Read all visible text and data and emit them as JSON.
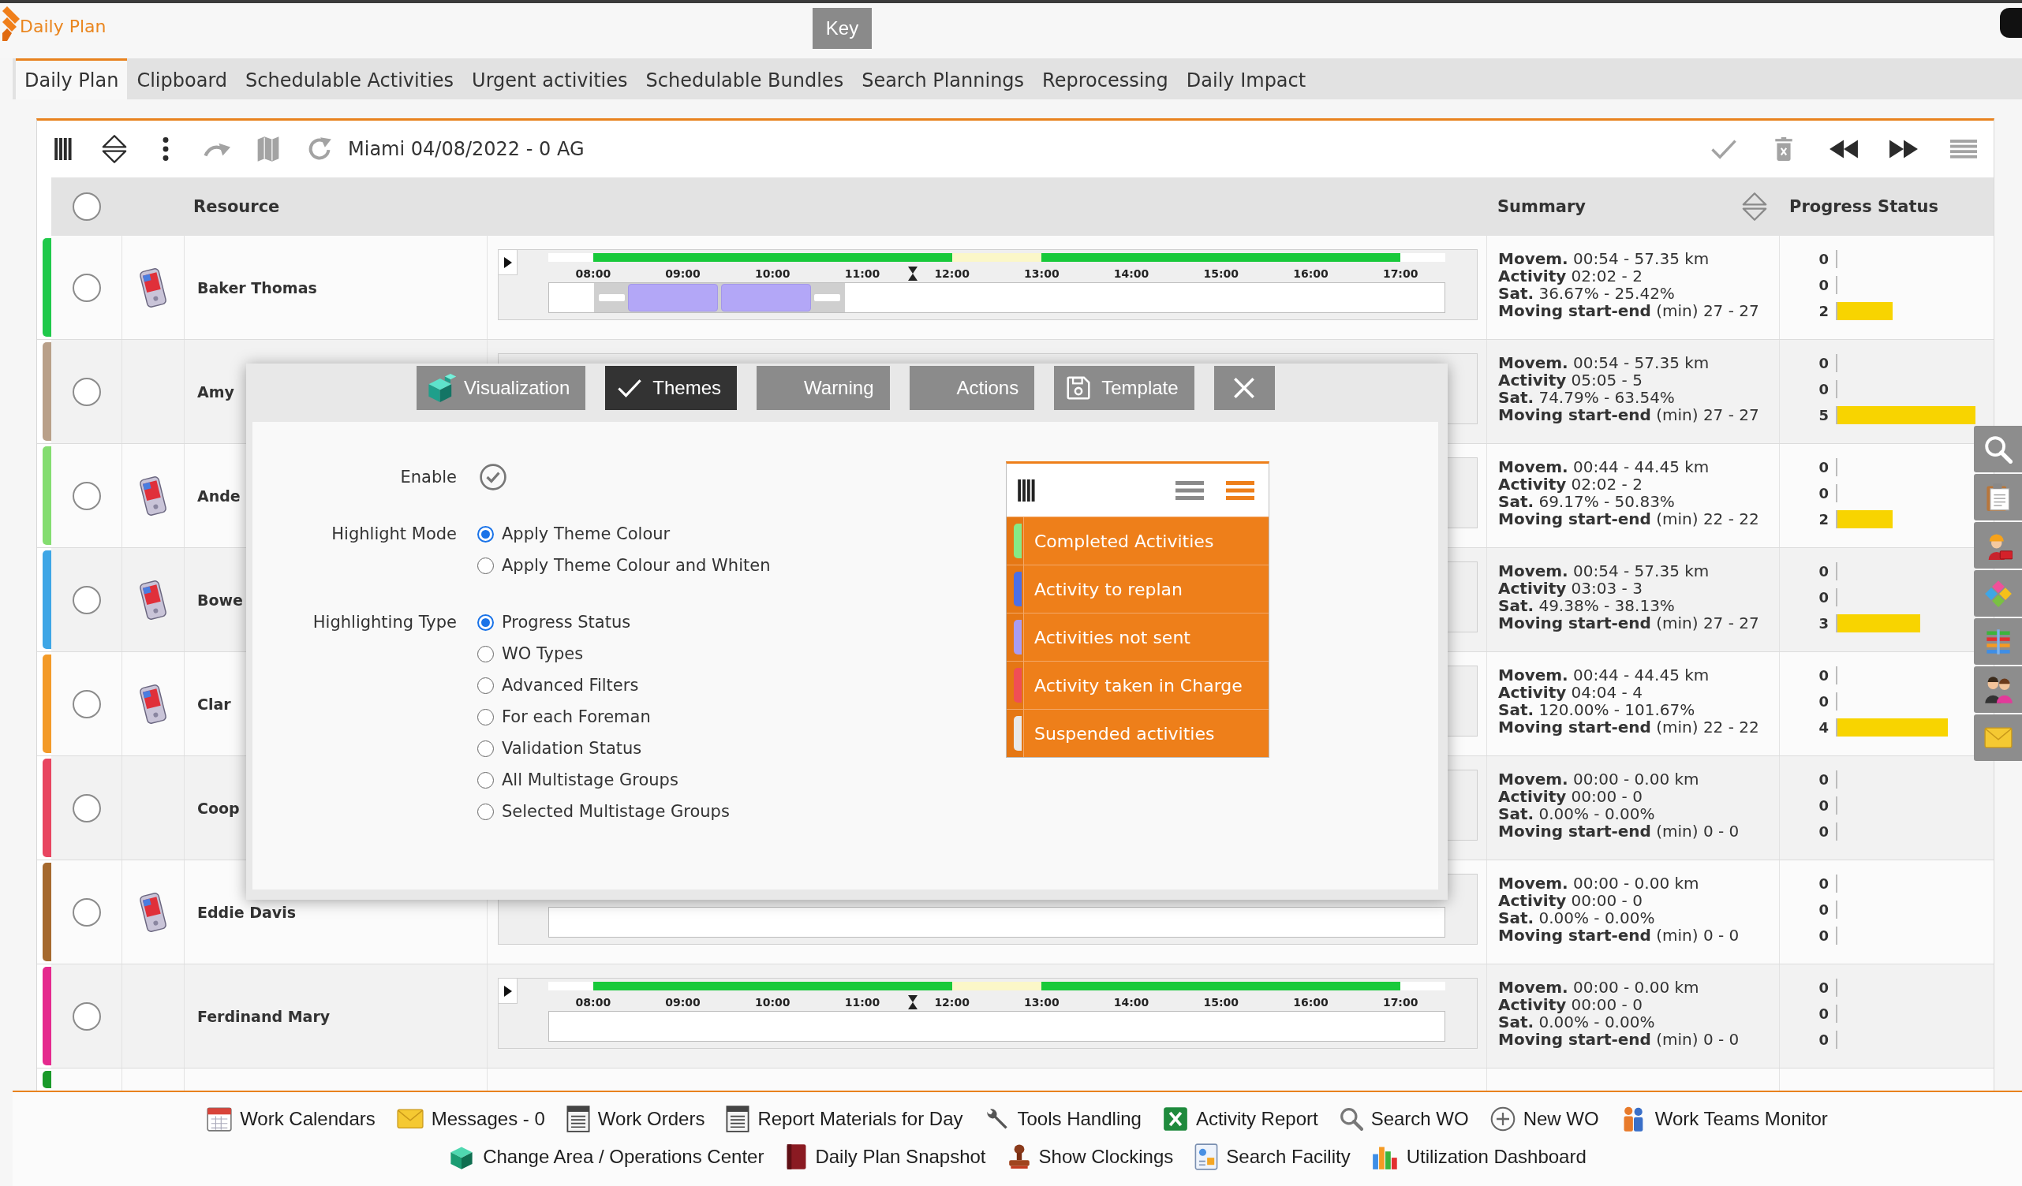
{
  "app": {
    "title": "Daily Plan",
    "tooltip": "Key"
  },
  "tabs": [
    {
      "label": "Daily Plan",
      "selected": true
    },
    {
      "label": "Clipboard",
      "selected": false
    },
    {
      "label": "Schedulable Activities",
      "selected": false
    },
    {
      "label": "Urgent activities",
      "selected": false
    },
    {
      "label": "Schedulable Bundles",
      "selected": false
    },
    {
      "label": "Search Plannings",
      "selected": false
    },
    {
      "label": "Reprocessing",
      "selected": false
    },
    {
      "label": "Daily Impact",
      "selected": false
    }
  ],
  "toolbar": {
    "title": "Miami 04/08/2022 - 0 AG",
    "left_buttons": [
      {
        "disabled": false
      },
      {
        "disabled": false
      },
      {
        "disabled": false
      },
      {
        "disabled": true
      },
      {
        "disabled": true
      },
      {
        "disabled": true
      }
    ],
    "right_buttons": [
      {
        "disabled": true
      },
      {
        "disabled": true
      },
      {
        "disabled": false
      },
      {
        "disabled": false
      },
      {
        "disabled": true
      }
    ]
  },
  "table": {
    "columns": [
      "Resource",
      "Summary",
      "Progress Status"
    ],
    "select_all": {
      "checked": false
    },
    "rows": [
      {
        "name": "Baker Thomas",
        "color": "#1fc94a",
        "checked": false,
        "device": true,
        "track": true,
        "hours": [
          "08:00",
          "09:00",
          "10:00",
          "11:00",
          "12:00",
          "13:00",
          "14:00",
          "15:00",
          "16:00",
          "17:00"
        ],
        "activities": [
          {
            "kind": "travel"
          },
          {
            "kind": "activity"
          },
          {
            "kind": "activity"
          },
          {
            "kind": "travel"
          }
        ],
        "summary": [
          "**Movem.** 00:54 - 57.35 km",
          "**Activity** 02:02 - 2",
          "**Sat.** 36.67% - 25.42%",
          "**Moving start-end** (min) 27 - 27"
        ],
        "progress": [
          {
            "count": "0"
          },
          {
            "count": "0"
          },
          {
            "count": "2",
            "level": 0.4
          }
        ]
      },
      {
        "name": "Amy",
        "color": "#b9a089",
        "checked": false,
        "device": false,
        "summary": [
          "**Movem.** 00:54 - 57.35 km",
          "**Activity** 05:05 - 5",
          "**Sat.** 74.79% - 63.54%",
          "**Moving start-end** (min) 27 - 27"
        ],
        "progress": [
          {
            "count": "0"
          },
          {
            "count": "0"
          },
          {
            "count": "5",
            "level": 1
          }
        ]
      },
      {
        "name": "Ande",
        "color": "#84dd70",
        "checked": false,
        "device": true,
        "summary": [
          "**Movem.** 00:44 - 44.45 km",
          "**Activity** 02:02 - 2",
          "**Sat.** 69.17% - 50.83%",
          "**Moving start-end** (min) 22 - 22"
        ],
        "progress": [
          {
            "count": "0"
          },
          {
            "count": "0"
          },
          {
            "count": "2",
            "level": 0.4
          }
        ]
      },
      {
        "name": "Bowe",
        "color": "#3ea6e6",
        "checked": false,
        "device": true,
        "summary": [
          "**Movem.** 00:54 - 57.35 km",
          "**Activity** 03:03 - 3",
          "**Sat.** 49.38% - 38.13%",
          "**Moving start-end** (min) 27 - 27"
        ],
        "progress": [
          {
            "count": "0"
          },
          {
            "count": "0"
          },
          {
            "count": "3",
            "level": 0.6
          }
        ]
      },
      {
        "name": "Clar",
        "color": "#f39a28",
        "checked": false,
        "device": true,
        "summary": [
          "**Movem.** 00:44 - 44.45 km",
          "**Activity** 04:04 - 4",
          "**Sat.** 120.00% - 101.67%",
          "**Moving start-end** (min) 22 - 22"
        ],
        "progress": [
          {
            "count": "0"
          },
          {
            "count": "0"
          },
          {
            "count": "4",
            "level": 0.8
          }
        ]
      },
      {
        "name": "Coop",
        "color": "#e84560",
        "checked": false,
        "device": false,
        "summary": [
          "**Movem.** 00:00 - 0.00 km",
          "**Activity** 00:00 - 0",
          "**Sat.** 0.00% - 0.00%",
          "**Moving start-end** (min) 0 - 0"
        ],
        "progress": [
          {
            "count": "0"
          },
          {
            "count": "0"
          },
          {
            "count": "0"
          }
        ]
      },
      {
        "name": "Eddie Davis",
        "color": "#a5692e",
        "checked": false,
        "device": true,
        "track": true,
        "summary": [
          "**Movem.** 00:00 - 0.00 km",
          "**Activity** 00:00 - 0",
          "**Sat.** 0.00% - 0.00%",
          "**Moving start-end** (min) 0 - 0"
        ],
        "progress": [
          {
            "count": "0"
          },
          {
            "count": "0"
          },
          {
            "count": "0"
          }
        ]
      },
      {
        "name": "Ferdinand Mary",
        "color": "#e52a8e",
        "checked": false,
        "device": false,
        "track": true,
        "hours": [
          "08:00",
          "09:00",
          "10:00",
          "11:00",
          "12:00",
          "13:00",
          "14:00",
          "15:00",
          "16:00",
          "17:00"
        ],
        "summary": [
          "**Movem.** 00:00 - 0.00 km",
          "**Activity** 00:00 - 0",
          "**Sat.** 0.00% - 0.00%",
          "**Moving start-end** (min) 0 - 0"
        ],
        "progress": [
          {
            "count": "0"
          },
          {
            "count": "0"
          },
          {
            "count": "0"
          }
        ]
      }
    ],
    "partial_row": {
      "color": "#1a9a2a"
    }
  },
  "dialog": {
    "tabs": [
      {
        "label": "Visualization",
        "selected": false
      },
      {
        "label": "Themes",
        "selected": true
      },
      {
        "label": "Warning",
        "selected": false
      },
      {
        "label": "Actions",
        "selected": false
      },
      {
        "label": "Template",
        "selected": false
      }
    ],
    "enable": {
      "label": "Enable",
      "checked": true
    },
    "groups": [
      {
        "label": "Highlight Mode",
        "options": [
          {
            "label": "Apply Theme Colour",
            "selected": true
          },
          {
            "label": "Apply Theme Colour and Whiten",
            "selected": false
          }
        ]
      },
      {
        "label": "Highlighting Type",
        "options": [
          {
            "label": "Progress Status",
            "selected": true
          },
          {
            "label": "WO Types",
            "selected": false
          },
          {
            "label": "Advanced Filters",
            "selected": false
          },
          {
            "label": "For each Foreman",
            "selected": false
          },
          {
            "label": "Validation Status",
            "selected": false
          },
          {
            "label": "All Multistage Groups",
            "selected": false
          },
          {
            "label": "Selected Multistage Groups",
            "selected": false
          }
        ]
      }
    ],
    "legend": {
      "views": [
        {
          "selected": false
        },
        {
          "selected": true
        }
      ],
      "items": [
        {
          "label": "Completed Activities",
          "color": "#86ea86"
        },
        {
          "label": "Activity to replan",
          "color": "#4a6fe6"
        },
        {
          "label": "Activities not sent",
          "color": "#a99cf2"
        },
        {
          "label": "Activity taken in Charge",
          "color": "#f04e55"
        },
        {
          "label": "Suspended activities",
          "color": "#e9e9e9"
        }
      ]
    }
  },
  "bottom_bar": {
    "rows": [
      {
        "items": [
          "Work Calendars",
          "Messages - 0",
          "Work Orders",
          "Report Materials for Day",
          "Tools Handling",
          "Activity Report",
          "Search WO",
          "New WO",
          "Work Teams Monitor"
        ]
      },
      {
        "items": [
          "Change Area / Operations Center",
          "Daily Plan Snapshot",
          "Show Clockings",
          "Search Facility",
          "Utilization Dashboard"
        ]
      }
    ]
  }
}
